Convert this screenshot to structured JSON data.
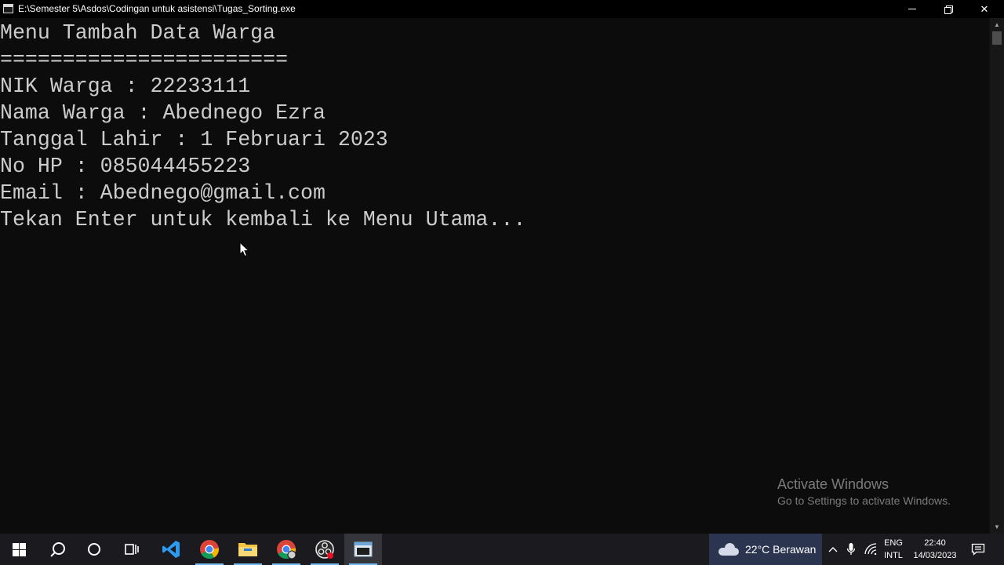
{
  "window": {
    "title": "E:\\Semester 5\\Asdos\\Codingan untuk asistensi\\Tugas_Sorting.exe",
    "close_glyph": "✕"
  },
  "console": {
    "lines": [
      "Menu Tambah Data Warga",
      "=======================",
      "NIK Warga : 22233111",
      "Nama Warga : Abednego Ezra",
      "Tanggal Lahir : 1 Februari 2023",
      "No HP : 085044455223",
      "Email : Abednego@gmail.com",
      "Tekan Enter untuk kembali ke Menu Utama..."
    ]
  },
  "watermark": {
    "title": "Activate Windows",
    "subtitle": "Go to Settings to activate Windows."
  },
  "taskbar": {
    "apps": [
      "start-icon",
      "search-icon",
      "cortana-icon",
      "task-view-icon",
      "vscode-icon",
      "chrome-icon",
      "file-explorer-icon",
      "chrome-profile-icon",
      "obs-icon",
      "console-app-icon"
    ],
    "weather": {
      "temperature": "22°C",
      "condition": "Berawan"
    },
    "language": {
      "line1": "ENG",
      "line2": "INTL"
    },
    "clock": {
      "time": "22:40",
      "date": "14/03/2023"
    },
    "tray_chevron": "^"
  },
  "colors": {
    "console_bg": "#0c0c0c",
    "console_text": "#cccccc",
    "taskbar_bg": "#1b1b1f",
    "active_underline": "#76b9ed",
    "vscode_blue": "#2c9af1",
    "explorer_yellow": "#f4c542"
  }
}
